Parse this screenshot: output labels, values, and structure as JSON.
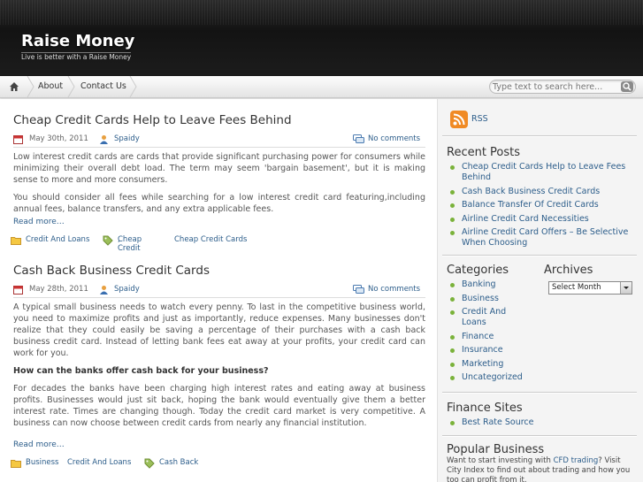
{
  "site": {
    "title": "Raise Money",
    "description": "Live is better with a Raise Money"
  },
  "nav": {
    "items": [
      {
        "label": "About"
      },
      {
        "label": "Contact Us"
      }
    ],
    "search_placeholder": "Type text to search here..."
  },
  "posts": [
    {
      "title": "Cheap Credit Cards Help to Leave Fees Behind",
      "date": "May 30th, 2011",
      "author": "Spaidy",
      "comments": "No comments",
      "paragraphs": [
        "Low interest credit cards are cards that provide significant purchasing power for consumers while minimizing their overall debt load. The term may seem 'bargain basement', but it is making sense to more and more consumers.",
        "You should consider all fees while searching for a low interest credit card featuring,including annual fees, balance transfers, and any extra applicable fees."
      ],
      "read_more": "Read more…",
      "categories": [
        "Credit And Loans"
      ],
      "tags": [
        "Cheap Credit",
        "Cheap Credit Cards"
      ]
    },
    {
      "title": "Cash Back Business Credit Cards",
      "date": "May 28th, 2011",
      "author": "Spaidy",
      "comments": "No comments",
      "paragraphs": [
        "A typical small business needs to watch every penny. To last in the competitive business world, you need to maximize profits and just as importantly, reduce expenses. Many businesses don't realize that they could easily be saving a percentage of their purchases with a cash back business credit card. Instead of letting bank fees eat away at your profits, your credit card can work for you.",
        "For decades the banks have been charging high interest rates and eating away at business profits. Businesses would just sit back, hoping the bank would eventually give them a better interest rate. Times are changing though. Today the credit card market is very competitive. A business can now choose between credit cards from nearly any financial institution."
      ],
      "subheading": "How can the banks offer cash back for your business?",
      "read_more": "Read more…",
      "categories": [
        "Business",
        "Credit And Loans"
      ],
      "tags": [
        "Cash Back"
      ]
    }
  ],
  "sidebar": {
    "rss": "RSS",
    "recent_title": "Recent Posts",
    "recent": [
      "Cheap Credit Cards Help to Leave Fees Behind",
      "Cash Back Business Credit Cards",
      "Balance Transfer Of Credit Cards",
      "Airline Credit Card Necessities",
      "Airline Credit Card Offers – Be Selective When Choosing"
    ],
    "categories_title": "Categories",
    "categories": [
      "Banking",
      "Business",
      "Credit And Loans",
      "Finance",
      "Insurance",
      "Marketing",
      "Uncategorized"
    ],
    "archives_title": "Archives",
    "archives_select": "Select Month",
    "finance_title": "Finance Sites",
    "finance": [
      "Best Rate Source"
    ],
    "popular_title": "Popular Business",
    "popular_text_1": "Want to start investing with ",
    "popular_link": "CFD trading",
    "popular_text_2": "? Visit City Index to find out about trading and how you too can profit from it."
  },
  "colors": {
    "link": "#2c5d8a",
    "bullet": "#7ab23a",
    "header": "#1a1a1a"
  }
}
